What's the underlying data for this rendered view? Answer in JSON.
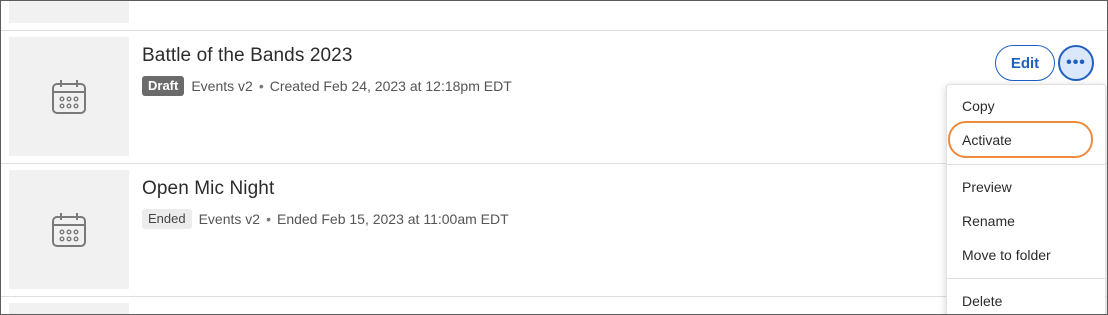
{
  "rows": [
    {
      "title": "Battle of the Bands 2023",
      "status": "Draft",
      "type": "Events v2",
      "detail": "Created Feb 24, 2023 at 12:18pm EDT"
    },
    {
      "title": "Open Mic Night",
      "status": "Ended",
      "type": "Events v2",
      "detail": "Ended Feb 15, 2023 at 11:00am EDT"
    }
  ],
  "separator": "•",
  "actions": {
    "edit_label": "Edit",
    "more_label": "•••"
  },
  "menu": {
    "items": [
      "Copy",
      "Activate",
      "Preview",
      "Rename",
      "Move to folder",
      "Delete"
    ],
    "highlighted": "Activate"
  },
  "colors": {
    "accent": "#1f5fbf",
    "highlight": "#f08a3c",
    "draft_badge": "#6b6b6b",
    "ended_badge": "#ececec"
  },
  "icons": {
    "thumbnail": "calendar-icon",
    "more": "ellipsis-icon"
  }
}
